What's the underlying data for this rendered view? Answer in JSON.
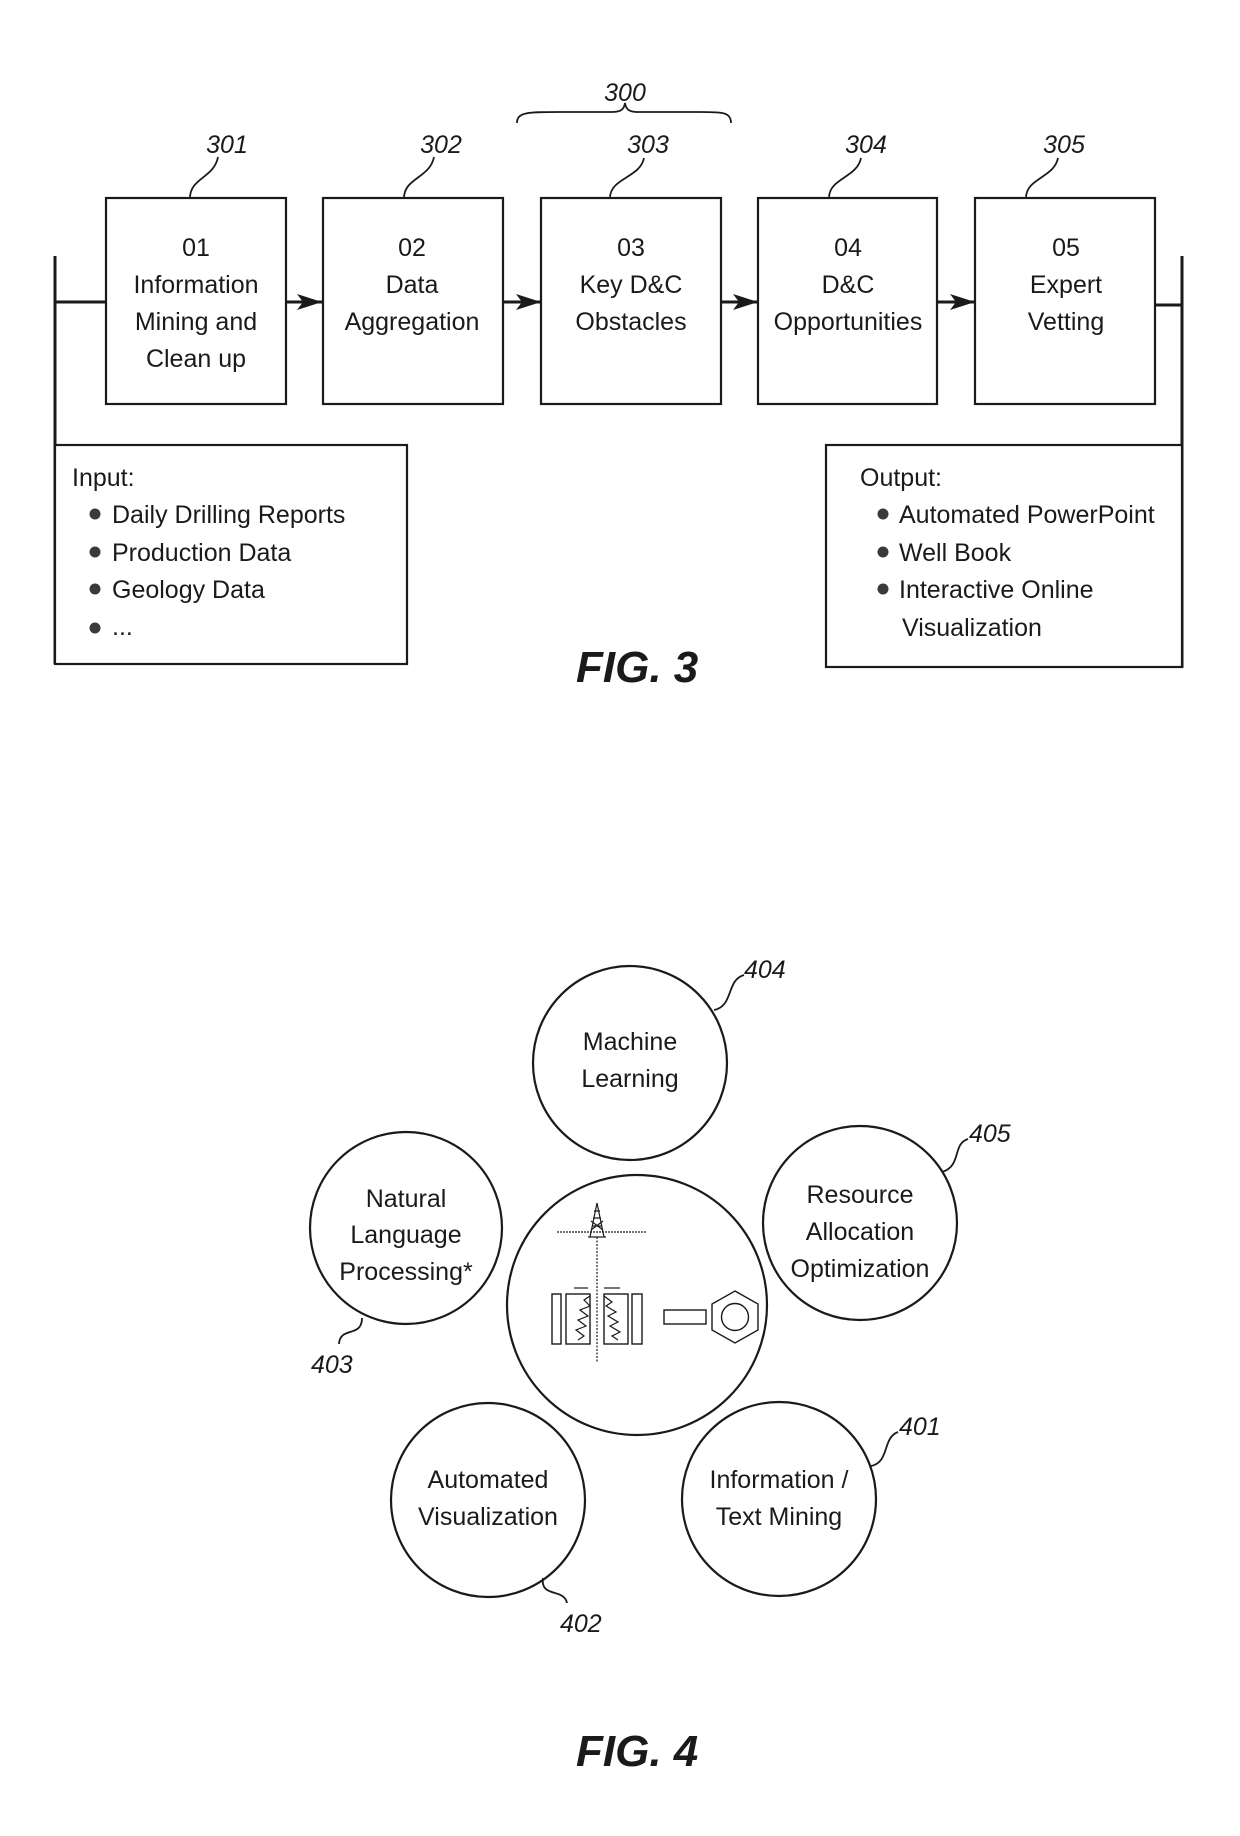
{
  "fig3": {
    "caption": "FIG. 3",
    "group_ref": "300",
    "steps": [
      {
        "ref": "301",
        "number": "01",
        "lines": [
          "Information",
          "Mining and",
          "Clean up"
        ]
      },
      {
        "ref": "302",
        "number": "02",
        "lines": [
          "Data",
          "Aggregation"
        ]
      },
      {
        "ref": "303",
        "number": "03",
        "lines": [
          "Key D&C",
          "Obstacles"
        ]
      },
      {
        "ref": "304",
        "number": "04",
        "lines": [
          "D&C",
          "Opportunities"
        ]
      },
      {
        "ref": "305",
        "number": "05",
        "lines": [
          "Expert",
          "Vetting"
        ]
      }
    ],
    "input": {
      "title": "Input:",
      "items": [
        "Daily Drilling Reports",
        "Production Data",
        "Geology Data",
        "..."
      ]
    },
    "output": {
      "title": "Output:",
      "items": [
        [
          "Automated PowerPoint"
        ],
        [
          "Well Book"
        ],
        [
          "Interactive Online",
          "Visualization"
        ]
      ]
    }
  },
  "fig4": {
    "caption": "FIG. 4",
    "center_icon": "drilling-rig-and-bolt-icon",
    "nodes": [
      {
        "ref": "401",
        "lines": [
          "Information /",
          "Text Mining"
        ]
      },
      {
        "ref": "402",
        "lines": [
          "Automated",
          "Visualization"
        ]
      },
      {
        "ref": "403",
        "lines": [
          "Natural",
          "Language",
          "Processing*"
        ]
      },
      {
        "ref": "404",
        "lines": [
          "Machine",
          "Learning"
        ]
      },
      {
        "ref": "405",
        "lines": [
          "Resource",
          "Allocation",
          "Optimization"
        ]
      }
    ]
  }
}
